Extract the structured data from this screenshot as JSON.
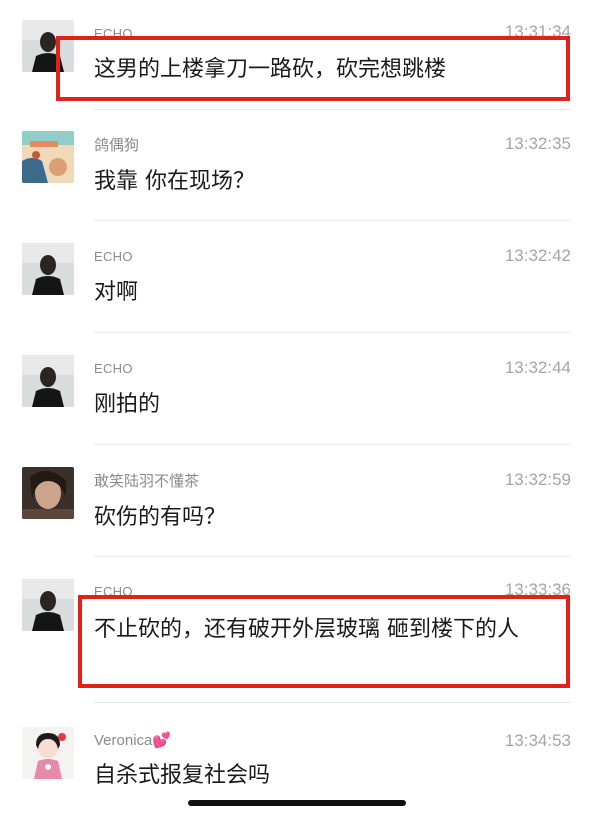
{
  "messages": [
    {
      "sender": "ECHO",
      "time": "13:31:34",
      "text": "这男的上楼拿刀一路砍，砍完想跳楼",
      "avatar": "echo-avatar"
    },
    {
      "sender": "鸽偶狗",
      "time": "13:32:35",
      "text": "我靠 你在现场？",
      "avatar": "illustration-avatar"
    },
    {
      "sender": "ECHO",
      "time": "13:32:42",
      "text": "对啊",
      "avatar": "echo-avatar"
    },
    {
      "sender": "ECHO",
      "time": "13:32:44",
      "text": "刚拍的",
      "avatar": "echo-avatar"
    },
    {
      "sender": "敢笑陆羽不懂茶",
      "time": "13:32:59",
      "text": "砍伤的有吗？",
      "avatar": "woman-photo-avatar"
    },
    {
      "sender": "ECHO",
      "time": "13:33:36",
      "text": "不止砍的，还有破开外层玻璃 砸到楼下的人",
      "avatar": "echo-avatar"
    },
    {
      "sender": "Veronica",
      "sender_emoji": "💕",
      "time": "13:34:53",
      "text": "自杀式报复社会吗",
      "avatar": "cartoon-girl-avatar"
    }
  ],
  "colors": {
    "highlight": "#e02318",
    "time": "#a5a5a5",
    "sender": "#8a8a8a"
  }
}
